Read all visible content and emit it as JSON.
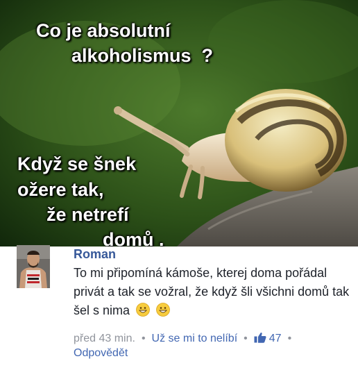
{
  "image": {
    "question_line1": "Co je absolutní",
    "question_line2": "alkoholismus  ?",
    "answer_line1": "Když se šnek",
    "answer_line2": "ožere tak,",
    "answer_line3": "že netrefí",
    "answer_line4": "domů ."
  },
  "comment": {
    "author": "Roman",
    "text": "To mi připomíná kámoše, kterej doma pořádal privát a tak se vožral, že když šli všichni domů tak šel s nima",
    "emoji_1": "grinning-face-icon",
    "emoji_2": "grinning-face-icon",
    "time": "před 43 min.",
    "unlike_label": "Už se mi to nelíbí",
    "like_count": "47",
    "reply_label": "Odpovědět",
    "colors": {
      "link": "#4267b2",
      "author": "#365899",
      "meta": "#90949c",
      "text": "#1d2129"
    }
  }
}
